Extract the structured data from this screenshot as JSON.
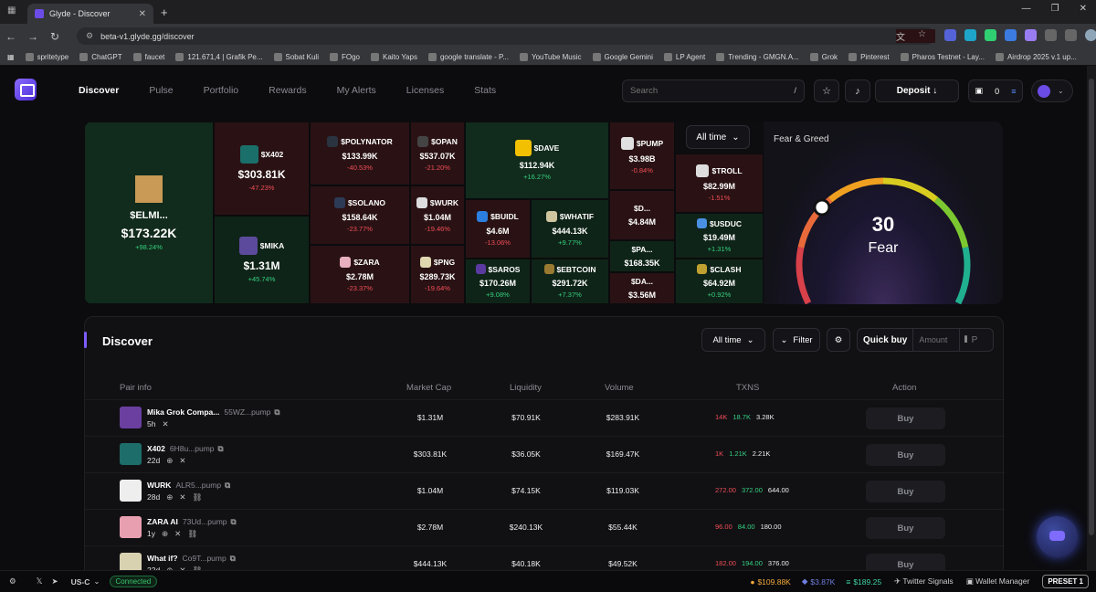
{
  "browser": {
    "tab_title": "Glyde - Discover",
    "url": "beta-v1.glyde.gg/discover",
    "bookmarks": [
      "spritetype",
      "ChatGPT",
      "faucet",
      "121.671,4 | Grafik Pe...",
      "Sobat Kuli",
      "FOgo",
      "Kaito Yaps",
      "google translate - P...",
      "YouTube Music",
      "Google Gemini",
      "LP Agent",
      "Trending - GMGN.A...",
      "Grok",
      "Pinterest",
      "Pharos Testnet - Lay...",
      "Airdrop 2025 v.1 up..."
    ]
  },
  "nav": {
    "items": [
      "Discover",
      "Pulse",
      "Portfolio",
      "Rewards",
      "My Alerts",
      "Licenses",
      "Stats"
    ],
    "search_placeholder": "Search",
    "slash": "/",
    "deposit": "Deposit ↓",
    "wallet_count": "0"
  },
  "heatmap": {
    "alltime": "All time",
    "tiles": [
      {
        "sym": "$ELMI...",
        "mc": "$173.22K",
        "ch": "+98.24%"
      },
      {
        "sym": "$X402",
        "mc": "$303.81K",
        "ch": "-47.23%"
      },
      {
        "sym": "$MIKA",
        "mc": "$1.31M",
        "ch": "+45.74%"
      },
      {
        "sym": "$POLYNATOR",
        "mc": "$133.99K",
        "ch": "-40.53%"
      },
      {
        "sym": "$OPAN",
        "mc": "$537.07K",
        "ch": "-21.20%"
      },
      {
        "sym": "$SOLANO",
        "mc": "$158.64K",
        "ch": "-23.77%"
      },
      {
        "sym": "$WURK",
        "mc": "$1.04M",
        "ch": "-19.46%"
      },
      {
        "sym": "$ZARA",
        "mc": "$2.78M",
        "ch": "-23.37%"
      },
      {
        "sym": "$PNG",
        "mc": "$289.73K",
        "ch": "-19.64%"
      },
      {
        "sym": "$DAVE",
        "mc": "$112.94K",
        "ch": "+16.27%"
      },
      {
        "sym": "$BUIDL",
        "mc": "$4.6M",
        "ch": "-13.06%"
      },
      {
        "sym": "$WHATIF",
        "mc": "$444.13K",
        "ch": "+9.77%"
      },
      {
        "sym": "$SAROS",
        "mc": "$170.26M",
        "ch": "+9.08%"
      },
      {
        "sym": "$EBTCOIN",
        "mc": "$291.72K",
        "ch": "+7.37%"
      },
      {
        "sym": "$PUMP",
        "mc": "$3.98B",
        "ch": "-0.84%"
      },
      {
        "sym": "$D...",
        "mc": "$4.84M",
        "ch": ""
      },
      {
        "sym": "$PA...",
        "mc": "$168.35K",
        "ch": ""
      },
      {
        "sym": "$DA...",
        "mc": "$3.56M",
        "ch": ""
      },
      {
        "sym": "$TROLL",
        "mc": "$82.99M",
        "ch": "-1.51%"
      },
      {
        "sym": "$USDUC",
        "mc": "$19.49M",
        "ch": "+1.31%"
      },
      {
        "sym": "$CLASH",
        "mc": "$64.92M",
        "ch": "+0.92%"
      }
    ]
  },
  "fear_greed": {
    "title": "Fear & Greed",
    "value": "30",
    "label": "Fear",
    "level": 30
  },
  "discover": {
    "title": "Discover",
    "alltime": "All time",
    "filter": "Filter",
    "quick_buy": "Quick buy",
    "amount_placeholder": "Amount",
    "preset_hint": "P",
    "columns": [
      "Pair info",
      "Market Cap",
      "Liquidity",
      "Volume",
      "TXNS",
      "Action"
    ],
    "rows": [
      {
        "name": "Mika Grok Compa...",
        "addr": "55WZ...pump",
        "age": "5h",
        "mc": "$1.31M",
        "liq": "$70.91K",
        "vol": "$283.91K",
        "t1": "14K",
        "t2": "18.7K",
        "t3": "3.28K",
        "buy": "Buy",
        "color": "#6b3fa0"
      },
      {
        "name": "X402",
        "addr": "6H8u...pump",
        "age": "22d",
        "mc": "$303.81K",
        "liq": "$36.05K",
        "vol": "$169.47K",
        "t1": "1K",
        "t2": "1.21K",
        "t3": "2.21K",
        "buy": "Buy",
        "color": "#1d6d6a"
      },
      {
        "name": "WURK",
        "addr": "ALR5...pump",
        "age": "28d",
        "mc": "$1.04M",
        "liq": "$74.15K",
        "vol": "$119.03K",
        "t1": "272.00",
        "t2": "372.00",
        "t3": "644.00",
        "buy": "Buy",
        "color": "#eeeeee"
      },
      {
        "name": "ZARA AI",
        "addr": "73Ud...pump",
        "age": "1y",
        "mc": "$2.78M",
        "liq": "$240.13K",
        "vol": "$55.44K",
        "t1": "96.00",
        "t2": "84.00",
        "t3": "180.00",
        "buy": "Buy",
        "color": "#e8a0b0"
      },
      {
        "name": "What if?",
        "addr": "Co9T...pump",
        "age": "22d",
        "mc": "$444.13K",
        "liq": "$40.18K",
        "vol": "$49.52K",
        "t1": "182.00",
        "t2": "194.00",
        "t3": "376.00",
        "buy": "Buy",
        "color": "#d9d2b0"
      }
    ]
  },
  "status": {
    "region": "US-C",
    "connected": "Connected",
    "btc": "$109.88K",
    "eth": "$3.87K",
    "sol": "$189.25",
    "twitter": "Twitter Signals",
    "wallet_mgr": "Wallet Manager",
    "preset": "PRESET 1"
  }
}
